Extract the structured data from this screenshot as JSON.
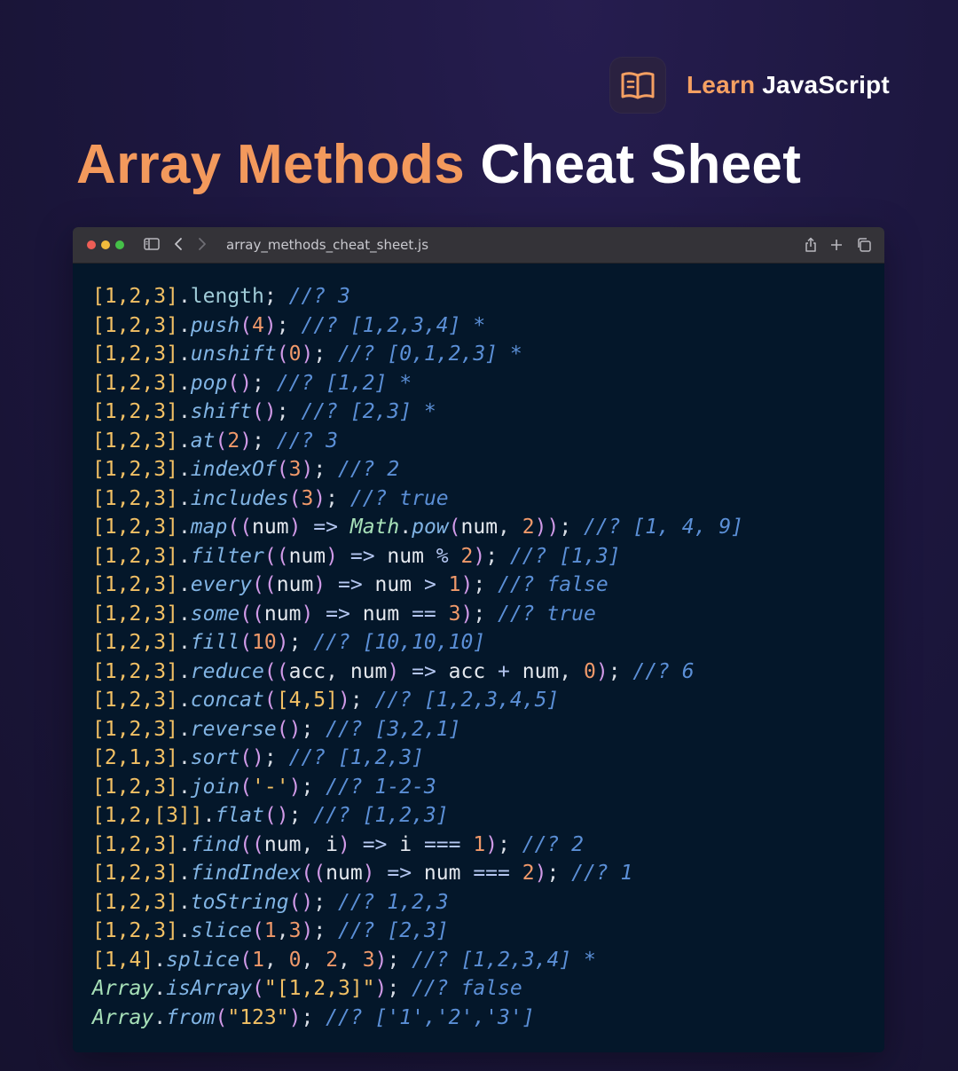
{
  "brand": {
    "learn": "Learn",
    "javascript": "JavaScript",
    "logo_icon": "open-book-icon"
  },
  "headline": {
    "accent": "Array Methods",
    "rest": "Cheat Sheet"
  },
  "window": {
    "filename": "array_methods_cheat_sheet.js",
    "icons": [
      "sidebar-icon",
      "back-icon",
      "forward-icon",
      "share-icon",
      "plus-icon",
      "tabs-icon"
    ]
  },
  "colors": {
    "background": "#1d1740",
    "accent": "#f3995c",
    "code_background": "#04172a",
    "titlebar": "#343338"
  },
  "code_lines": [
    [
      [
        "[1,2,3]",
        "o"
      ],
      [
        ".",
        "p"
      ],
      [
        "length",
        "pr"
      ],
      [
        "; ",
        "p"
      ],
      [
        "//? 3",
        "c"
      ]
    ],
    [
      [
        "[1,2,3]",
        "o"
      ],
      [
        ".",
        "p"
      ],
      [
        "push",
        "m"
      ],
      [
        "(",
        "pa"
      ],
      [
        "4",
        "n"
      ],
      [
        ")",
        "pa"
      ],
      [
        "; ",
        "p"
      ],
      [
        "//? [1,2,3,4] *",
        "c"
      ]
    ],
    [
      [
        "[1,2,3]",
        "o"
      ],
      [
        ".",
        "p"
      ],
      [
        "unshift",
        "m"
      ],
      [
        "(",
        "pa"
      ],
      [
        "0",
        "n"
      ],
      [
        ")",
        "pa"
      ],
      [
        "; ",
        "p"
      ],
      [
        "//? [0,1,2,3] *",
        "c"
      ]
    ],
    [
      [
        "[1,2,3]",
        "o"
      ],
      [
        ".",
        "p"
      ],
      [
        "pop",
        "m"
      ],
      [
        "()",
        "pa"
      ],
      [
        "; ",
        "p"
      ],
      [
        "//? [1,2] *",
        "c"
      ]
    ],
    [
      [
        "[1,2,3]",
        "o"
      ],
      [
        ".",
        "p"
      ],
      [
        "shift",
        "m"
      ],
      [
        "()",
        "pa"
      ],
      [
        "; ",
        "p"
      ],
      [
        "//? [2,3] *",
        "c"
      ]
    ],
    [
      [
        "[1,2,3]",
        "o"
      ],
      [
        ".",
        "p"
      ],
      [
        "at",
        "m"
      ],
      [
        "(",
        "pa"
      ],
      [
        "2",
        "n"
      ],
      [
        ")",
        "pa"
      ],
      [
        "; ",
        "p"
      ],
      [
        "//? 3",
        "c"
      ]
    ],
    [
      [
        "[1,2,3]",
        "o"
      ],
      [
        ".",
        "p"
      ],
      [
        "indexOf",
        "m"
      ],
      [
        "(",
        "pa"
      ],
      [
        "3",
        "n"
      ],
      [
        ")",
        "pa"
      ],
      [
        "; ",
        "p"
      ],
      [
        "//? 2",
        "c"
      ]
    ],
    [
      [
        "[1,2,3]",
        "o"
      ],
      [
        ".",
        "p"
      ],
      [
        "includes",
        "m"
      ],
      [
        "(",
        "pa"
      ],
      [
        "3",
        "n"
      ],
      [
        ")",
        "pa"
      ],
      [
        "; ",
        "p"
      ],
      [
        "//? true",
        "c"
      ]
    ],
    [
      [
        "[1,2,3]",
        "o"
      ],
      [
        ".",
        "p"
      ],
      [
        "map",
        "m"
      ],
      [
        "((",
        "pa"
      ],
      [
        "num",
        "v"
      ],
      [
        ")",
        "pa"
      ],
      [
        " => ",
        "op"
      ],
      [
        "Math",
        "k"
      ],
      [
        ".",
        "p"
      ],
      [
        "pow",
        "m"
      ],
      [
        "(",
        "pa"
      ],
      [
        "num",
        "v"
      ],
      [
        ", ",
        "p"
      ],
      [
        "2",
        "n"
      ],
      [
        "))",
        "pa"
      ],
      [
        "; ",
        "p"
      ],
      [
        "//? [1, 4, 9]",
        "c"
      ]
    ],
    [
      [
        "[1,2,3]",
        "o"
      ],
      [
        ".",
        "p"
      ],
      [
        "filter",
        "m"
      ],
      [
        "((",
        "pa"
      ],
      [
        "num",
        "v"
      ],
      [
        ")",
        "pa"
      ],
      [
        " => ",
        "op"
      ],
      [
        "num",
        "v"
      ],
      [
        " % ",
        "op"
      ],
      [
        "2",
        "n"
      ],
      [
        ")",
        "pa"
      ],
      [
        "; ",
        "p"
      ],
      [
        "//? [1,3]",
        "c"
      ]
    ],
    [
      [
        "[1,2,3]",
        "o"
      ],
      [
        ".",
        "p"
      ],
      [
        "every",
        "m"
      ],
      [
        "((",
        "pa"
      ],
      [
        "num",
        "v"
      ],
      [
        ")",
        "pa"
      ],
      [
        " => ",
        "op"
      ],
      [
        "num",
        "v"
      ],
      [
        " > ",
        "op"
      ],
      [
        "1",
        "n"
      ],
      [
        ")",
        "pa"
      ],
      [
        "; ",
        "p"
      ],
      [
        "//? false",
        "c"
      ]
    ],
    [
      [
        "[1,2,3]",
        "o"
      ],
      [
        ".",
        "p"
      ],
      [
        "some",
        "m"
      ],
      [
        "((",
        "pa"
      ],
      [
        "num",
        "v"
      ],
      [
        ")",
        "pa"
      ],
      [
        " => ",
        "op"
      ],
      [
        "num",
        "v"
      ],
      [
        " == ",
        "op"
      ],
      [
        "3",
        "n"
      ],
      [
        ")",
        "pa"
      ],
      [
        "; ",
        "p"
      ],
      [
        "//? true",
        "c"
      ]
    ],
    [
      [
        "[1,2,3]",
        "o"
      ],
      [
        ".",
        "p"
      ],
      [
        "fill",
        "m"
      ],
      [
        "(",
        "pa"
      ],
      [
        "10",
        "n"
      ],
      [
        ")",
        "pa"
      ],
      [
        "; ",
        "p"
      ],
      [
        "//? [10,10,10]",
        "c"
      ]
    ],
    [
      [
        "[1,2,3]",
        "o"
      ],
      [
        ".",
        "p"
      ],
      [
        "reduce",
        "m"
      ],
      [
        "((",
        "pa"
      ],
      [
        "acc",
        "v"
      ],
      [
        ", ",
        "p"
      ],
      [
        "num",
        "v"
      ],
      [
        ")",
        "pa"
      ],
      [
        " => ",
        "op"
      ],
      [
        "acc",
        "v"
      ],
      [
        " + ",
        "op"
      ],
      [
        "num",
        "v"
      ],
      [
        ", ",
        "p"
      ],
      [
        "0",
        "n"
      ],
      [
        ")",
        "pa"
      ],
      [
        "; ",
        "p"
      ],
      [
        "//? 6",
        "c"
      ]
    ],
    [
      [
        "[1,2,3]",
        "o"
      ],
      [
        ".",
        "p"
      ],
      [
        "concat",
        "m"
      ],
      [
        "(",
        "pa"
      ],
      [
        "[4,5]",
        "o"
      ],
      [
        ")",
        "pa"
      ],
      [
        "; ",
        "p"
      ],
      [
        "//? [1,2,3,4,5]",
        "c"
      ]
    ],
    [
      [
        "[1,2,3]",
        "o"
      ],
      [
        ".",
        "p"
      ],
      [
        "reverse",
        "m"
      ],
      [
        "()",
        "pa"
      ],
      [
        "; ",
        "p"
      ],
      [
        "//? [3,2,1]",
        "c"
      ]
    ],
    [
      [
        "[2,1,3]",
        "o"
      ],
      [
        ".",
        "p"
      ],
      [
        "sort",
        "m"
      ],
      [
        "()",
        "pa"
      ],
      [
        "; ",
        "p"
      ],
      [
        "//? [1,2,3]",
        "c"
      ]
    ],
    [
      [
        "[1,2,3]",
        "o"
      ],
      [
        ".",
        "p"
      ],
      [
        "join",
        "m"
      ],
      [
        "(",
        "pa"
      ],
      [
        "'-'",
        "s"
      ],
      [
        ")",
        "pa"
      ],
      [
        "; ",
        "p"
      ],
      [
        "//? 1-2-3",
        "c"
      ]
    ],
    [
      [
        "[1,2,[3]]",
        "o"
      ],
      [
        ".",
        "p"
      ],
      [
        "flat",
        "m"
      ],
      [
        "()",
        "pa"
      ],
      [
        "; ",
        "p"
      ],
      [
        "//? [1,2,3]",
        "c"
      ]
    ],
    [
      [
        "[1,2,3]",
        "o"
      ],
      [
        ".",
        "p"
      ],
      [
        "find",
        "m"
      ],
      [
        "((",
        "pa"
      ],
      [
        "num",
        "v"
      ],
      [
        ", ",
        "p"
      ],
      [
        "i",
        "v"
      ],
      [
        ")",
        "pa"
      ],
      [
        " => ",
        "op"
      ],
      [
        "i",
        "v"
      ],
      [
        " === ",
        "op"
      ],
      [
        "1",
        "n"
      ],
      [
        ")",
        "pa"
      ],
      [
        "; ",
        "p"
      ],
      [
        "//? 2",
        "c"
      ]
    ],
    [
      [
        "[1,2,3]",
        "o"
      ],
      [
        ".",
        "p"
      ],
      [
        "findIndex",
        "m"
      ],
      [
        "((",
        "pa"
      ],
      [
        "num",
        "v"
      ],
      [
        ")",
        "pa"
      ],
      [
        " => ",
        "op"
      ],
      [
        "num",
        "v"
      ],
      [
        " === ",
        "op"
      ],
      [
        "2",
        "n"
      ],
      [
        ")",
        "pa"
      ],
      [
        "; ",
        "p"
      ],
      [
        "//? 1",
        "c"
      ]
    ],
    [
      [
        "[1,2,3]",
        "o"
      ],
      [
        ".",
        "p"
      ],
      [
        "toString",
        "m"
      ],
      [
        "()",
        "pa"
      ],
      [
        "; ",
        "p"
      ],
      [
        "//? 1,2,3",
        "c"
      ]
    ],
    [
      [
        "[1,2,3]",
        "o"
      ],
      [
        ".",
        "p"
      ],
      [
        "slice",
        "m"
      ],
      [
        "(",
        "pa"
      ],
      [
        "1",
        "n"
      ],
      [
        ",",
        "p"
      ],
      [
        "3",
        "n"
      ],
      [
        ")",
        "pa"
      ],
      [
        "; ",
        "p"
      ],
      [
        "//? [2,3]",
        "c"
      ]
    ],
    [
      [
        "[1,4]",
        "o"
      ],
      [
        ".",
        "p"
      ],
      [
        "splice",
        "m"
      ],
      [
        "(",
        "pa"
      ],
      [
        "1",
        "n"
      ],
      [
        ", ",
        "p"
      ],
      [
        "0",
        "n"
      ],
      [
        ", ",
        "p"
      ],
      [
        "2",
        "n"
      ],
      [
        ", ",
        "p"
      ],
      [
        "3",
        "n"
      ],
      [
        ")",
        "pa"
      ],
      [
        "; ",
        "p"
      ],
      [
        "//? [1,2,3,4] *",
        "c"
      ]
    ],
    [
      [
        "Array",
        "k"
      ],
      [
        ".",
        "p"
      ],
      [
        "isArray",
        "m"
      ],
      [
        "(",
        "pa"
      ],
      [
        "\"[1,2,3]\"",
        "s"
      ],
      [
        ")",
        "pa"
      ],
      [
        "; ",
        "p"
      ],
      [
        "//? false",
        "c"
      ]
    ],
    [
      [
        "Array",
        "k"
      ],
      [
        ".",
        "p"
      ],
      [
        "from",
        "m"
      ],
      [
        "(",
        "pa"
      ],
      [
        "\"123\"",
        "s"
      ],
      [
        ")",
        "pa"
      ],
      [
        "; ",
        "p"
      ],
      [
        "//? ['1','2','3']",
        "c"
      ]
    ]
  ]
}
